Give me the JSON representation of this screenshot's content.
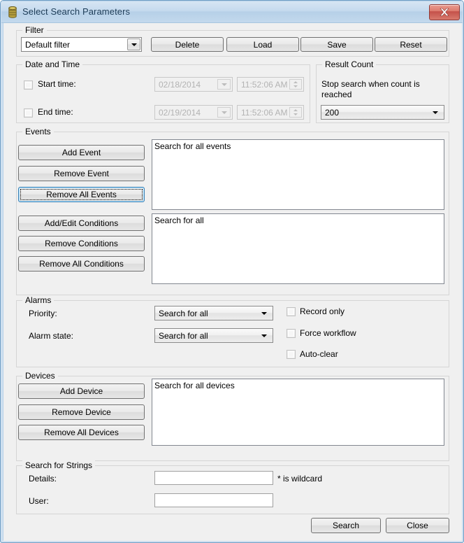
{
  "window": {
    "title": "Select Search Parameters",
    "icon": "database-icon",
    "close_label": "x",
    "accent_titlebar": "#c2d9ed",
    "accent_close": "#c4514a",
    "accent_focus": "#3c7fb1"
  },
  "filter": {
    "legend": "Filter",
    "combo_value": "Default filter",
    "buttons": [
      {
        "label": "Delete"
      },
      {
        "label": "Load"
      },
      {
        "label": "Save"
      },
      {
        "label": "Reset"
      }
    ]
  },
  "date_and_time": {
    "legend": "Date and Time",
    "start": {
      "label": "Start time:",
      "checked": false,
      "date": "02/18/2014",
      "time": "11:52:06 AM"
    },
    "end": {
      "label": "End time:",
      "checked": false,
      "date": "02/19/2014",
      "time": "11:52:06 AM"
    }
  },
  "result_count": {
    "legend": "Result Count",
    "description_line1": "Stop search when count is",
    "description_line2": "reached",
    "value": "200"
  },
  "events": {
    "legend": "Events",
    "buttons": [
      {
        "label": "Add Event",
        "focused": false
      },
      {
        "label": "Remove Event",
        "focused": false
      },
      {
        "label": "Remove All Events",
        "focused": true
      },
      {
        "label": "Add/Edit Conditions",
        "focused": false
      },
      {
        "label": "Remove Conditions",
        "focused": false
      },
      {
        "label": "Remove All Conditions",
        "focused": false
      }
    ],
    "events_pane_text": "Search for all events",
    "conditions_pane_text": "Search for all"
  },
  "alarms": {
    "legend": "Alarms",
    "priority_label": "Priority:",
    "priority_value": "Search for all",
    "state_label": "Alarm state:",
    "state_value": "Search for all",
    "checkboxes": [
      {
        "label": "Record only",
        "checked": false
      },
      {
        "label": "Force workflow",
        "checked": false
      },
      {
        "label": "Auto-clear",
        "checked": false
      }
    ]
  },
  "devices": {
    "legend": "Devices",
    "buttons": [
      {
        "label": "Add Device"
      },
      {
        "label": "Remove Device"
      },
      {
        "label": "Remove All Devices"
      }
    ],
    "pane_text": "Search for all devices"
  },
  "search_strings": {
    "legend": "Search for Strings",
    "details_label": "Details:",
    "details_value": "",
    "details_placeholder": "",
    "user_label": "User:",
    "user_value": "",
    "user_placeholder": "",
    "wildcard_hint": "* is wildcard"
  },
  "footer": {
    "search_label": "Search",
    "close_label": "Close"
  }
}
